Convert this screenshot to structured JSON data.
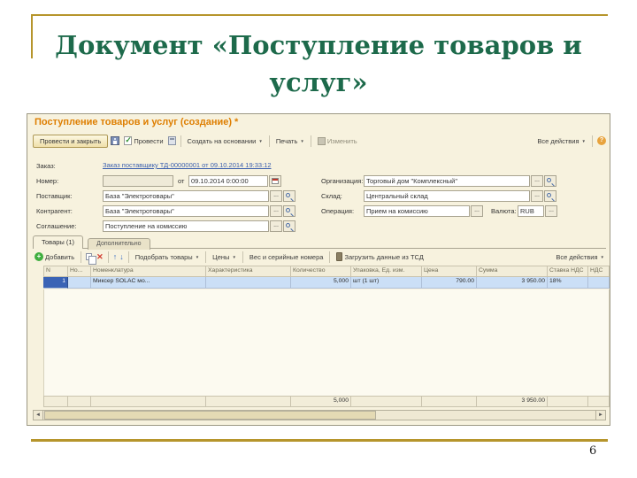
{
  "slide": {
    "title_line1": "Документ «Поступление товаров и",
    "title_line2": "услуг»",
    "page_number": "6"
  },
  "window": {
    "title": "Поступление товаров и услуг (создание) *",
    "toolbar_main": {
      "post_and_close": "Провести и закрыть",
      "post": "Провести",
      "create_based_on": "Создать на основании",
      "print": "Печать",
      "edit": "Изменить",
      "all_actions": "Все действия"
    },
    "form": {
      "order_label": "Заказ:",
      "order_link": "Заказ поставщику ТД-00000001 от 09.10.2014 19:33:12",
      "number_label": "Номер:",
      "number_value": "",
      "from_label": "от",
      "date_value": "09.10.2014  0:00:00",
      "org_label": "Организация:",
      "org_value": "Торговый дом \"Комплексный\"",
      "supplier_label": "Поставщик:",
      "supplier_value": "База \"Электротовары\"",
      "warehouse_label": "Склад:",
      "warehouse_value": "Центральный склад",
      "counterparty_label": "Контрагент:",
      "counterparty_value": "База \"Электротовары\"",
      "operation_label": "Операция:",
      "operation_value": "Прием на комиссию",
      "currency_label": "Валюта:",
      "currency_value": "RUB",
      "agreement_label": "Соглашение:",
      "agreement_value": "Поступление на комиссию"
    },
    "tabs": {
      "goods": "Товары (1)",
      "additional": "Дополнительно"
    },
    "toolbar_table": {
      "add": "Добавить",
      "pick_goods": "Подобрать товары",
      "prices": "Цены",
      "weight_serial": "Вес и серийные номера",
      "load_tsd": "Загрузить данные из ТСД",
      "all_actions": "Все действия"
    },
    "table": {
      "columns": [
        "N",
        "Но...",
        "Номенклатура",
        "Характеристика",
        "Количество",
        "Упаковка, Ед. изм.",
        "Цена",
        "Сумма",
        "Ставка НДС",
        "НДС"
      ],
      "rows": [
        {
          "n": "1",
          "no": "",
          "nomenclature": "Миксер SOLAC мо...",
          "characteristic": "",
          "quantity": "5,000",
          "package": "шт (1 шт)",
          "price": "790.00",
          "sum": "3 950.00",
          "vat_rate": "18%",
          "vat": ""
        }
      ],
      "totals": {
        "quantity": "5,000",
        "sum": "3 950.00"
      }
    }
  },
  "icons": {
    "caret": "▼",
    "dots": "...",
    "delete": "✕",
    "up": "↑",
    "down": "↓",
    "left": "◄",
    "right": "►",
    "help": "?",
    "plus": "+"
  }
}
